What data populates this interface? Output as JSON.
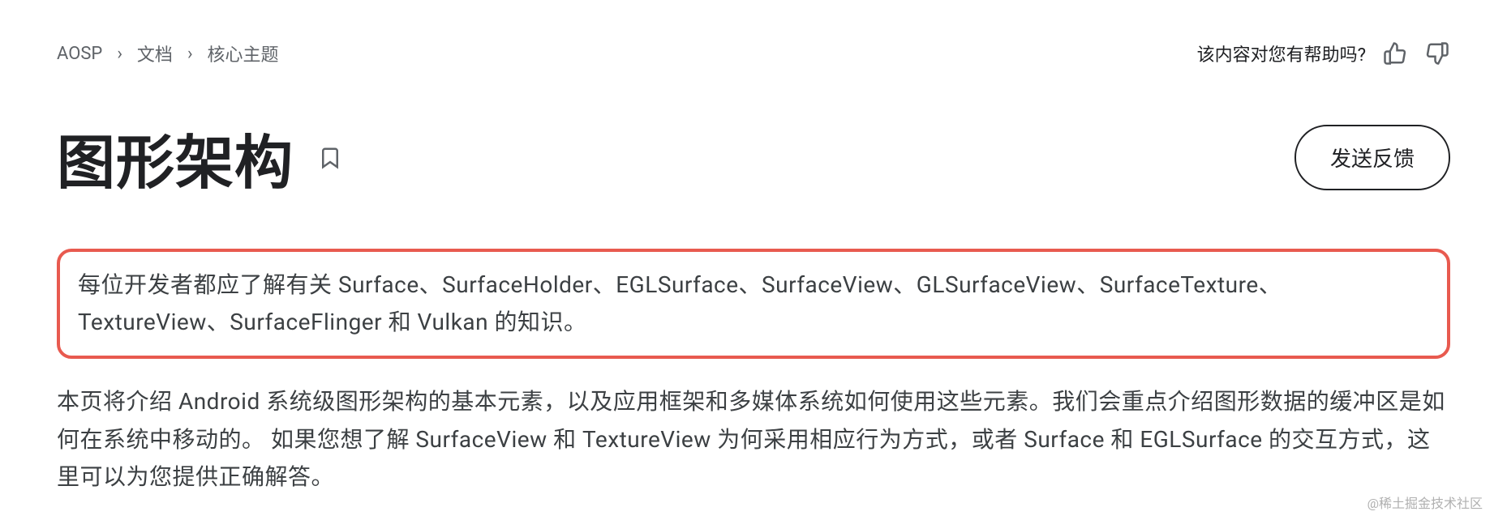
{
  "breadcrumb": {
    "items": [
      "AOSP",
      "文档",
      "核心主题"
    ]
  },
  "feedback": {
    "prompt": "该内容对您有帮助吗?",
    "send_button": "发送反馈"
  },
  "page": {
    "title": "图形架构"
  },
  "content": {
    "highlighted_paragraph": "每位开发者都应了解有关 Surface、SurfaceHolder、EGLSurface、SurfaceView、GLSurfaceView、SurfaceTexture、TextureView、SurfaceFlinger 和 Vulkan 的知识。",
    "paragraph2": "本页将介绍 Android 系统级图形架构的基本元素，以及应用框架和多媒体系统如何使用这些元素。我们会重点介绍图形数据的缓冲区是如何在系统中移动的。 如果您想了解 SurfaceView 和 TextureView 为何采用相应行为方式，或者 Surface 和 EGLSurface 的交互方式，这里可以为您提供正确解答。"
  },
  "watermark": "@稀土掘金技术社区"
}
